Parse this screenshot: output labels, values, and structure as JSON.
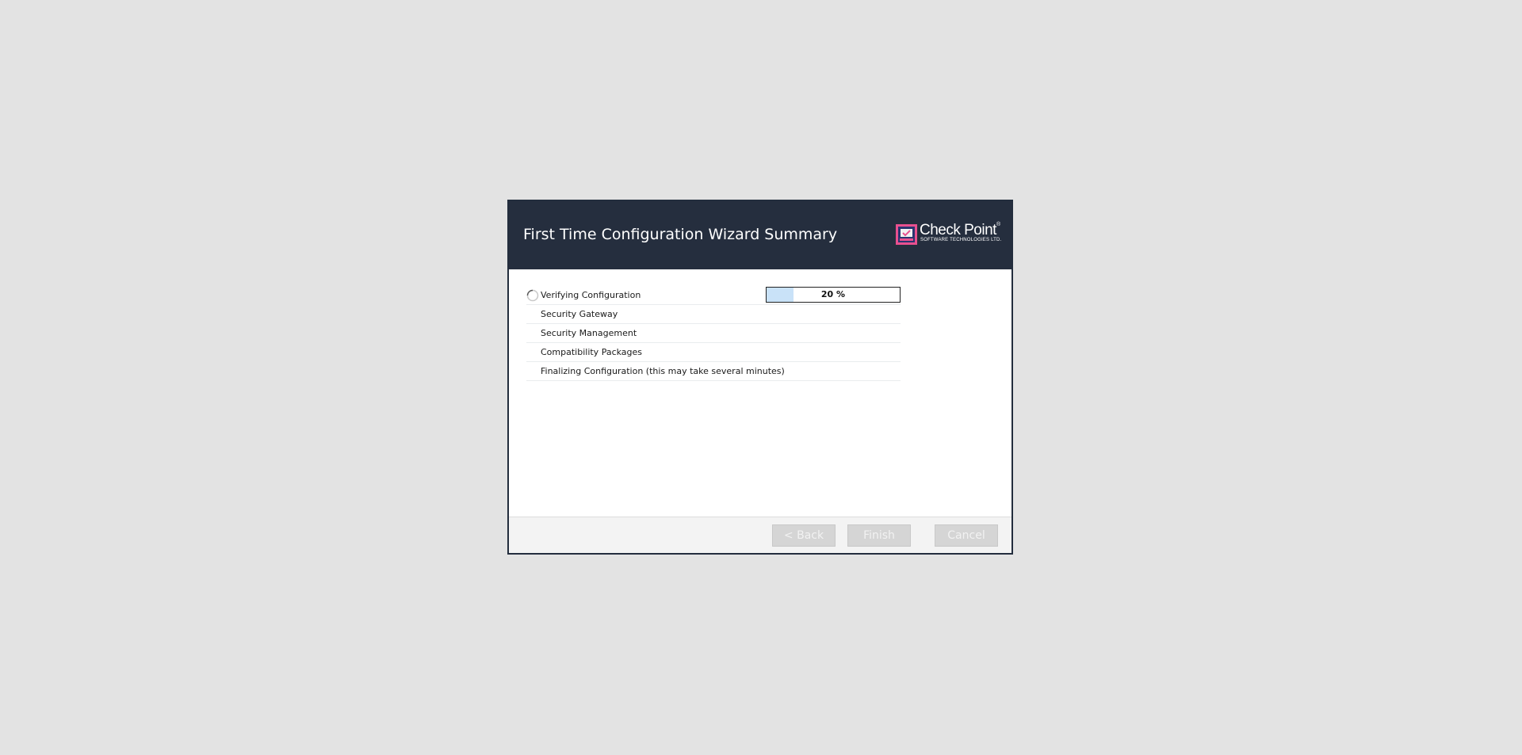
{
  "dialog": {
    "title": "First Time Configuration Wizard Summary",
    "logo": {
      "name": "Check Point",
      "registered": "®",
      "subtitle": "SOFTWARE TECHNOLOGIES LTD."
    }
  },
  "steps": [
    {
      "label": "Verifying Configuration",
      "status": "in-progress",
      "progress_label": "20 %",
      "progress_fraction": 0.2
    },
    {
      "label": "Security Gateway",
      "status": "pending"
    },
    {
      "label": "Security Management",
      "status": "pending"
    },
    {
      "label": "Compatibility Packages",
      "status": "pending"
    },
    {
      "label": "Finalizing Configuration (this may take several minutes)",
      "status": "pending"
    }
  ],
  "buttons": {
    "back": "< Back",
    "finish": "Finish",
    "cancel": "Cancel"
  },
  "colors": {
    "header_bg": "#252e3e",
    "progress_fill": "#c9e2f8",
    "page_bg": "#e3e3e3"
  },
  "icons": {
    "spinner": "loading-spinner-icon",
    "logo": "check-point-logo-icon"
  }
}
